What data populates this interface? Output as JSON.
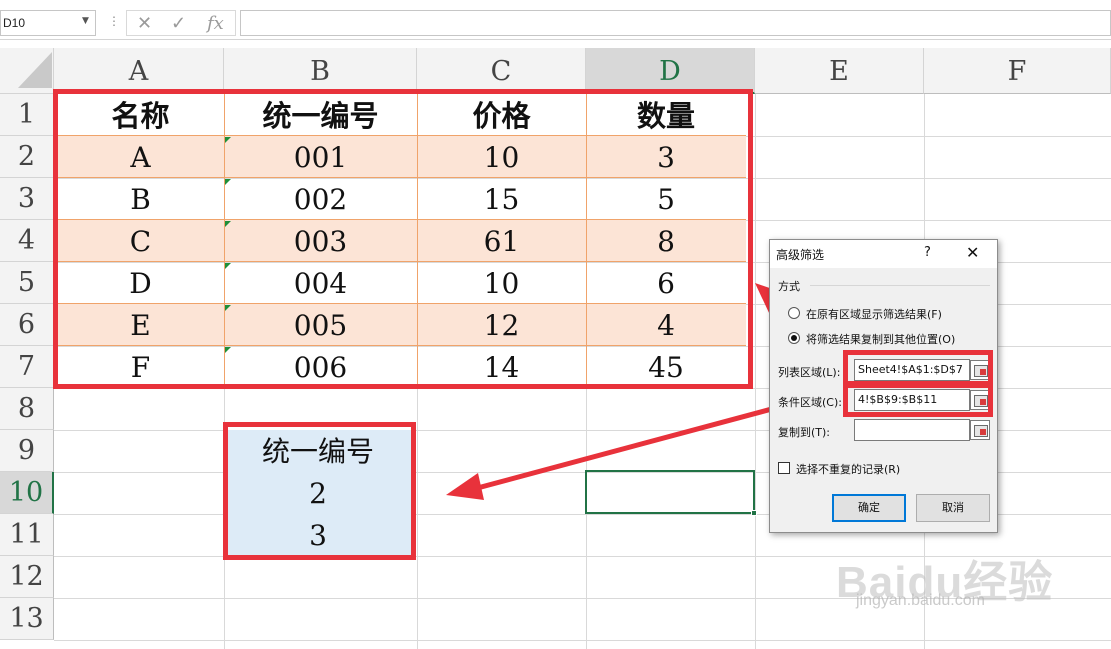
{
  "formula_bar": {
    "name_box": "D10",
    "dots": "⋮",
    "cancel_icon": "✕",
    "enter_icon": "✓",
    "fx_label": "fx",
    "formula": ""
  },
  "columns": [
    "A",
    "B",
    "C",
    "D",
    "E",
    "F"
  ],
  "selected_column": "D",
  "rows": [
    "1",
    "2",
    "3",
    "4",
    "5",
    "6",
    "7",
    "8",
    "9",
    "10",
    "11",
    "12",
    "13"
  ],
  "selected_row": "10",
  "table": {
    "headers": [
      "名称",
      "统一编号",
      "价格",
      "数量"
    ],
    "rows": [
      [
        "A",
        "001",
        "10",
        "3"
      ],
      [
        "B",
        "002",
        "15",
        "5"
      ],
      [
        "C",
        "003",
        "61",
        "8"
      ],
      [
        "D",
        "004",
        "10",
        "6"
      ],
      [
        "E",
        "005",
        "12",
        "4"
      ],
      [
        "F",
        "006",
        "14",
        "45"
      ]
    ]
  },
  "criteria": {
    "header": "统一编号",
    "values": [
      "2",
      "3"
    ]
  },
  "dialog": {
    "title": "高级筛选",
    "help": "?",
    "close": "✕",
    "method_label": "方式",
    "radio1": "在原有区域显示筛选结果(F)",
    "radio2": "将筛选结果复制到其他位置(O)",
    "list_range_label": "列表区域(L):",
    "list_range_value": "Sheet4!$A$1:$D$7",
    "criteria_range_label": "条件区域(C):",
    "criteria_range_value": "4!$B$9:$B$11",
    "copy_to_label": "复制到(T):",
    "copy_to_value": "",
    "unique_label": "选择不重复的记录(R)",
    "ok": "确定",
    "cancel": "取消"
  },
  "watermark": {
    "logo": "Baidu经验",
    "url": "jingyan.baidu.com"
  },
  "colors": {
    "annotation_red": "#e8323b",
    "table_band": "#fce4d6",
    "criteria_fill": "#ddebf7",
    "excel_green": "#217346"
  }
}
